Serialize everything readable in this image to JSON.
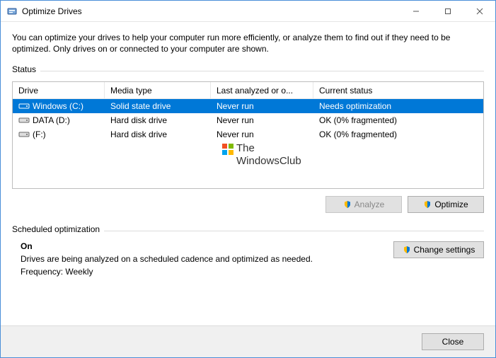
{
  "titlebar": {
    "title": "Optimize Drives"
  },
  "intro": "You can optimize your drives to help your computer run more efficiently, or analyze them to find out if they need to be optimized. Only drives on or connected to your computer are shown.",
  "status_label": "Status",
  "columns": {
    "drive": "Drive",
    "media": "Media type",
    "last": "Last analyzed or o...",
    "status": "Current status"
  },
  "drives": [
    {
      "name": "Windows (C:)",
      "media": "Solid state drive",
      "last": "Never run",
      "status": "Needs optimization",
      "selected": true,
      "icon": "ssd"
    },
    {
      "name": "DATA (D:)",
      "media": "Hard disk drive",
      "last": "Never run",
      "status": "OK (0% fragmented)",
      "selected": false,
      "icon": "hdd"
    },
    {
      "name": "(F:)",
      "media": "Hard disk drive",
      "last": "Never run",
      "status": "OK (0% fragmented)",
      "selected": false,
      "icon": "hdd"
    }
  ],
  "watermark": {
    "line1": "The",
    "line2": "WindowsClub"
  },
  "buttons": {
    "analyze": "Analyze",
    "optimize": "Optimize",
    "change_settings": "Change settings",
    "close": "Close"
  },
  "scheduled": {
    "label": "Scheduled optimization",
    "state": "On",
    "desc": "Drives are being analyzed on a scheduled cadence and optimized as needed.",
    "freq": "Frequency: Weekly"
  }
}
